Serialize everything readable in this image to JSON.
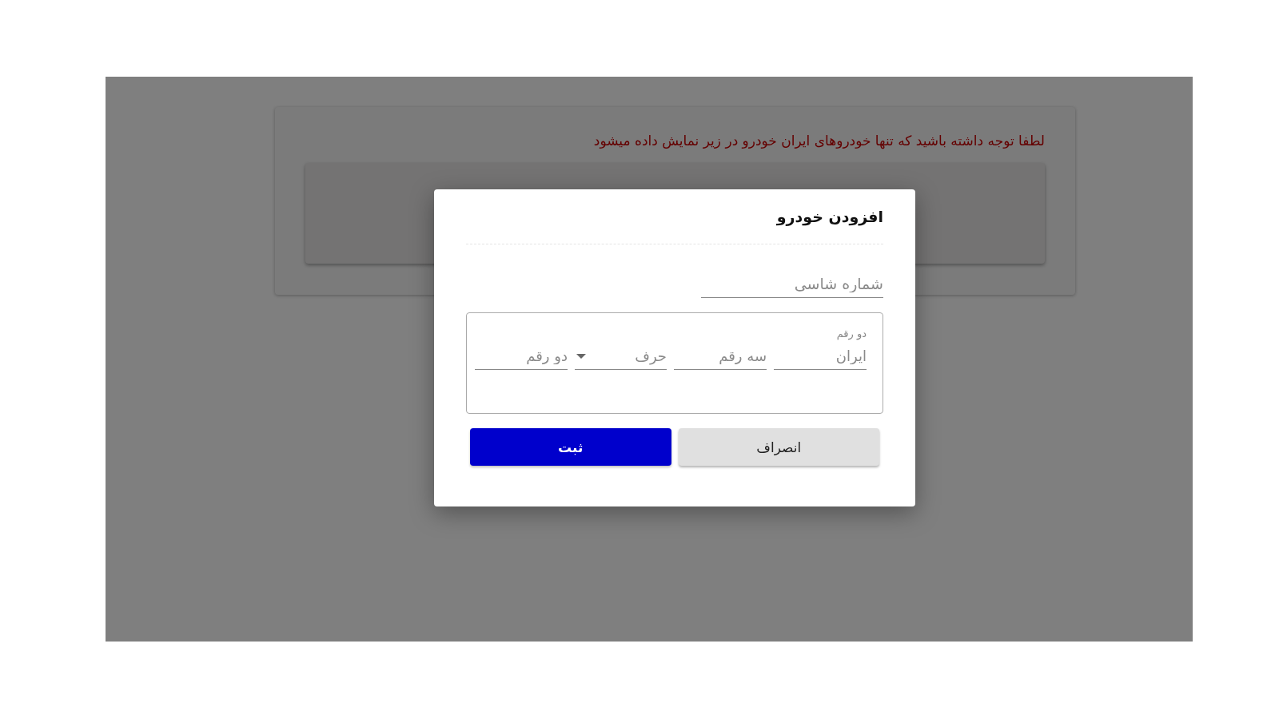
{
  "notice": "لطفا توجه داشته باشید که تنها خودروهای ایران خودرو در زیر نمایش داده میشود",
  "dialog": {
    "title": "افزودن خودرو",
    "chassis_field": {
      "placeholder": "شماره شاسی"
    },
    "plate": {
      "label": "دو رقم",
      "fields": [
        {
          "kind": "input",
          "placeholder": "ایران"
        },
        {
          "kind": "input",
          "placeholder": "سه رقم"
        },
        {
          "kind": "select",
          "placeholder": "حرف"
        },
        {
          "kind": "input",
          "placeholder": "دو رقم"
        }
      ]
    },
    "buttons": [
      {
        "kind": "secondary",
        "label": "انصراف"
      },
      {
        "kind": "primary",
        "label": "ثبت"
      }
    ]
  }
}
